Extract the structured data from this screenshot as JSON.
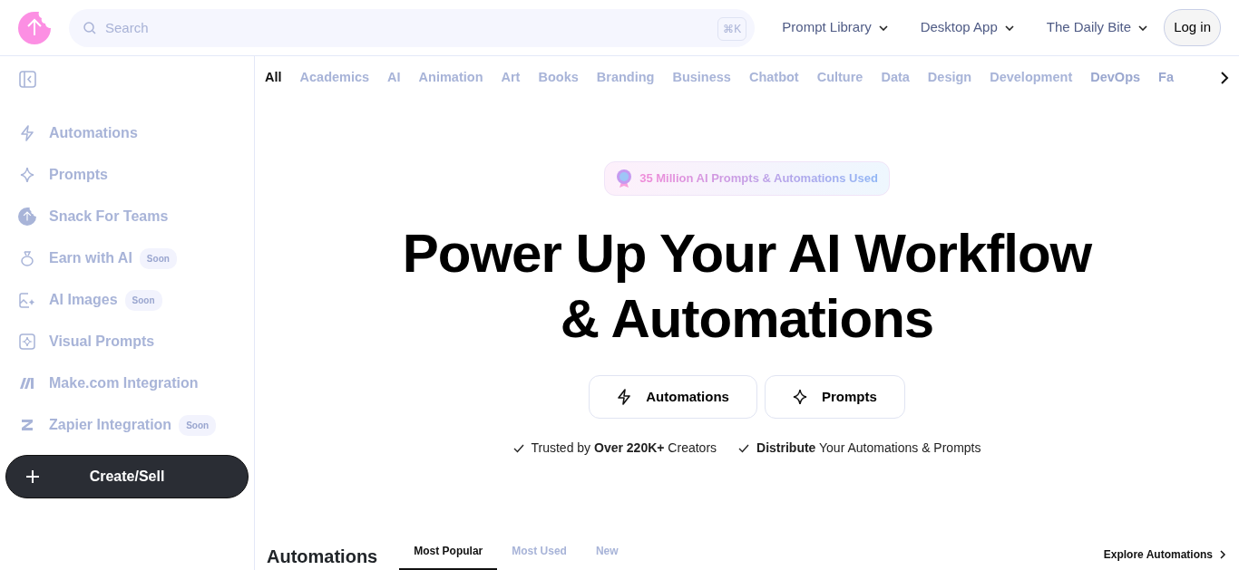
{
  "header": {
    "search": {
      "placeholder": "Search",
      "shortcut": "⌘K"
    },
    "nav": [
      {
        "label": "Prompt Library"
      },
      {
        "label": "Desktop App"
      },
      {
        "label": "The Daily Bite"
      }
    ],
    "login": "Log in"
  },
  "sidebar": {
    "items": [
      {
        "kind": "bolt",
        "label": "Automations"
      },
      {
        "kind": "sparkle",
        "label": "Prompts"
      },
      {
        "kind": "logo",
        "label": "Snack For Teams"
      },
      {
        "kind": "bag",
        "label": "Earn with AI",
        "badge": "Soon"
      },
      {
        "kind": "image",
        "label": "AI Images",
        "badge": "Soon"
      },
      {
        "kind": "frame",
        "label": "Visual Prompts"
      },
      {
        "kind": "make",
        "label": "Make.com Integration"
      },
      {
        "kind": "zapier",
        "label": "Zapier Integration",
        "badge": "Soon"
      }
    ],
    "create_button": "Create/Sell"
  },
  "categories": [
    {
      "label": "All",
      "selected": true
    },
    {
      "label": "Academics",
      "selected": false
    },
    {
      "label": "AI",
      "selected": false
    },
    {
      "label": "Animation",
      "selected": false
    },
    {
      "label": "Art",
      "selected": false
    },
    {
      "label": "Books",
      "selected": false
    },
    {
      "label": "Branding",
      "selected": false
    },
    {
      "label": "Business",
      "selected": false
    },
    {
      "label": "Chatbot",
      "selected": false
    },
    {
      "label": "Culture",
      "selected": false
    },
    {
      "label": "Data",
      "selected": false
    },
    {
      "label": "Design",
      "selected": false
    },
    {
      "label": "Development",
      "selected": false
    },
    {
      "label": "DevOps",
      "selected": false
    },
    {
      "label": "Fa",
      "selected": false
    }
  ],
  "hero": {
    "badge": "35 Million AI Prompts & Automations Used",
    "title_lines": [
      "Power Up Your AI Workflow",
      "& Automations"
    ],
    "buttons": [
      {
        "kind": "bolt",
        "label": "Automations"
      },
      {
        "kind": "sparkle",
        "label": "Prompts"
      }
    ],
    "features": [
      "Trusted by **Over 220K+** Creators",
      "**Distribute** Your Automations & Prompts"
    ]
  },
  "section": {
    "title": "Automations",
    "tabs": [
      {
        "label": "Most Popular",
        "selected": true
      },
      {
        "label": "Most Used",
        "selected": false
      },
      {
        "label": "New",
        "selected": false
      }
    ],
    "explore": "Explore Automations"
  }
}
